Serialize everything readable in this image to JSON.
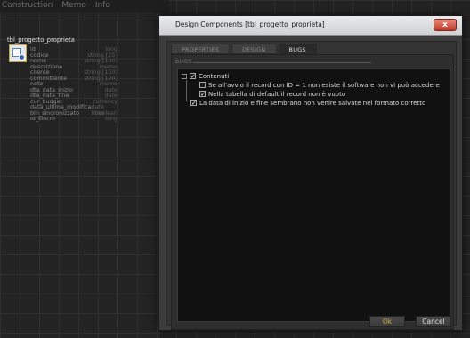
{
  "menu": {
    "items": [
      "Construction",
      "Memo",
      "Info"
    ]
  },
  "entity": {
    "title": "tbl_progetto_proprieta",
    "fields": [
      {
        "name": "id",
        "type": "long"
      },
      {
        "name": "codice",
        "type": "string [25]"
      },
      {
        "name": "nome",
        "type": "string [100]"
      },
      {
        "name": "descrizione",
        "type": "memo"
      },
      {
        "name": "cliente",
        "type": "string [100]"
      },
      {
        "name": "committente",
        "type": "string [100]"
      },
      {
        "name": "note",
        "type": "memo"
      },
      {
        "name": "dta_data_inizio",
        "type": "date"
      },
      {
        "name": "dta_data_fine",
        "type": "date"
      },
      {
        "name": "cur_budget",
        "type": "currency"
      },
      {
        "name": "data_ultima_modifica",
        "type": "date time"
      },
      {
        "name": "bln_sincronizzato",
        "type": "boolean"
      },
      {
        "name": "id_sincro",
        "type": "long"
      }
    ]
  },
  "dialog": {
    "title": "Design Components [tbl_progetto_proprieta]",
    "close_label": "x",
    "tabs": [
      "PROPERTIES",
      "DESIGN",
      "BUGS"
    ],
    "active_tab": "BUGS",
    "section_label": "BUGS",
    "tree": {
      "root": {
        "label": "Contenuti",
        "checked": true,
        "expander": "-"
      },
      "children": [
        {
          "label": "Se all'avvio il record con ID = 1 non esiste il software non vi può accedere",
          "checked": false
        },
        {
          "label": "Nella tabella di default il record non è vuoto",
          "checked": true
        }
      ],
      "item": {
        "label": "La data di inizio e fine sembrano non venire salvate nel formato corretto",
        "checked": true
      }
    },
    "ok_label": "Ok",
    "cancel_label": "Cancel"
  }
}
